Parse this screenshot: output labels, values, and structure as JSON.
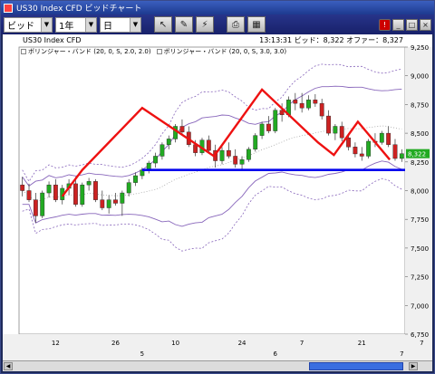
{
  "window": {
    "title": "US30 Index CFD ビッドチャート"
  },
  "toolbar": {
    "price_type": "ビッド",
    "period": "1年",
    "interval": "日",
    "tools": [
      {
        "name": "line-tool-icon",
        "glyph": "↖"
      },
      {
        "name": "pin-tool-icon",
        "glyph": "✎"
      },
      {
        "name": "trend-tool-icon",
        "glyph": "⚡"
      },
      {
        "name": "print-icon",
        "glyph": "⎙"
      },
      {
        "name": "chart-type-icon",
        "glyph": "▦"
      }
    ],
    "right_buttons": [
      {
        "name": "alert-icon",
        "glyph": "!"
      },
      {
        "name": "minimize-icon",
        "glyph": "_"
      },
      {
        "name": "maximize-icon",
        "glyph": "□"
      },
      {
        "name": "close-icon",
        "glyph": "×"
      }
    ]
  },
  "chart_header": {
    "symbol": "US30 Index CFD",
    "info": "13:13:31 ビッド：8,322 オファー：8,327"
  },
  "legend": [
    "ボリンジャー・バンド (20, 0, S, 2.0, 2.0)",
    "ボリンジャー・バンド (20, 0, S, 3.0, 3.0)"
  ],
  "current_price_label": "8,322",
  "chart_data": {
    "type": "candlestick",
    "y_ticks": [
      "9,250",
      "9,000",
      "8,750",
      "8,500",
      "8,250",
      "8,000",
      "7,750",
      "7,500",
      "7,250",
      "7,000",
      "6,750"
    ],
    "ylim": [
      6750,
      9250
    ],
    "x_day_labels": [
      "12",
      "26",
      "10",
      "24",
      "7",
      "21",
      "7"
    ],
    "x_month_labels": [
      "5",
      "6",
      "7"
    ],
    "candles": [
      {
        "o": 8050,
        "h": 8120,
        "l": 7950,
        "c": 8000
      },
      {
        "o": 8000,
        "h": 8060,
        "l": 7900,
        "c": 7920
      },
      {
        "o": 7920,
        "h": 7980,
        "l": 7720,
        "c": 7780
      },
      {
        "o": 7780,
        "h": 8000,
        "l": 7760,
        "c": 7980
      },
      {
        "o": 7980,
        "h": 8080,
        "l": 7940,
        "c": 8050
      },
      {
        "o": 8050,
        "h": 8100,
        "l": 7900,
        "c": 7920
      },
      {
        "o": 7920,
        "h": 8050,
        "l": 7880,
        "c": 8020
      },
      {
        "o": 8020,
        "h": 8100,
        "l": 7960,
        "c": 8060
      },
      {
        "o": 8060,
        "h": 8120,
        "l": 7860,
        "c": 7880
      },
      {
        "o": 7880,
        "h": 8070,
        "l": 7860,
        "c": 8050
      },
      {
        "o": 8050,
        "h": 8110,
        "l": 8000,
        "c": 8080
      },
      {
        "o": 8080,
        "h": 8100,
        "l": 7900,
        "c": 7920
      },
      {
        "o": 7920,
        "h": 8000,
        "l": 7830,
        "c": 7850
      },
      {
        "o": 7850,
        "h": 7960,
        "l": 7800,
        "c": 7920
      },
      {
        "o": 7920,
        "h": 7980,
        "l": 7870,
        "c": 7890
      },
      {
        "o": 7890,
        "h": 8000,
        "l": 7780,
        "c": 7980
      },
      {
        "o": 7980,
        "h": 8100,
        "l": 7950,
        "c": 8070
      },
      {
        "o": 8070,
        "h": 8160,
        "l": 8040,
        "c": 8130
      },
      {
        "o": 8130,
        "h": 8200,
        "l": 8100,
        "c": 8180
      },
      {
        "o": 8180,
        "h": 8260,
        "l": 8150,
        "c": 8240
      },
      {
        "o": 8240,
        "h": 8330,
        "l": 8200,
        "c": 8300
      },
      {
        "o": 8300,
        "h": 8420,
        "l": 8270,
        "c": 8400
      },
      {
        "o": 8400,
        "h": 8480,
        "l": 8360,
        "c": 8450
      },
      {
        "o": 8450,
        "h": 8580,
        "l": 8420,
        "c": 8560
      },
      {
        "o": 8560,
        "h": 8620,
        "l": 8480,
        "c": 8510
      },
      {
        "o": 8510,
        "h": 8560,
        "l": 8380,
        "c": 8400
      },
      {
        "o": 8400,
        "h": 8440,
        "l": 8300,
        "c": 8330
      },
      {
        "o": 8330,
        "h": 8460,
        "l": 8310,
        "c": 8440
      },
      {
        "o": 8440,
        "h": 8480,
        "l": 8320,
        "c": 8350
      },
      {
        "o": 8350,
        "h": 8400,
        "l": 8200,
        "c": 8260
      },
      {
        "o": 8260,
        "h": 8380,
        "l": 8230,
        "c": 8350
      },
      {
        "o": 8350,
        "h": 8420,
        "l": 8280,
        "c": 8300
      },
      {
        "o": 8300,
        "h": 8360,
        "l": 8200,
        "c": 8230
      },
      {
        "o": 8230,
        "h": 8300,
        "l": 8180,
        "c": 8270
      },
      {
        "o": 8270,
        "h": 8380,
        "l": 8250,
        "c": 8360
      },
      {
        "o": 8360,
        "h": 8500,
        "l": 8340,
        "c": 8480
      },
      {
        "o": 8480,
        "h": 8600,
        "l": 8450,
        "c": 8580
      },
      {
        "o": 8580,
        "h": 8650,
        "l": 8500,
        "c": 8520
      },
      {
        "o": 8520,
        "h": 8720,
        "l": 8500,
        "c": 8700
      },
      {
        "o": 8700,
        "h": 8760,
        "l": 8600,
        "c": 8660
      },
      {
        "o": 8660,
        "h": 8820,
        "l": 8640,
        "c": 8790
      },
      {
        "o": 8790,
        "h": 8850,
        "l": 8700,
        "c": 8760
      },
      {
        "o": 8760,
        "h": 8850,
        "l": 8680,
        "c": 8720
      },
      {
        "o": 8720,
        "h": 8830,
        "l": 8700,
        "c": 8790
      },
      {
        "o": 8790,
        "h": 8840,
        "l": 8730,
        "c": 8760
      },
      {
        "o": 8760,
        "h": 8800,
        "l": 8620,
        "c": 8650
      },
      {
        "o": 8650,
        "h": 8700,
        "l": 8480,
        "c": 8500
      },
      {
        "o": 8500,
        "h": 8580,
        "l": 8440,
        "c": 8560
      },
      {
        "o": 8560,
        "h": 8600,
        "l": 8430,
        "c": 8460
      },
      {
        "o": 8460,
        "h": 8500,
        "l": 8350,
        "c": 8380
      },
      {
        "o": 8380,
        "h": 8420,
        "l": 8290,
        "c": 8320
      },
      {
        "o": 8320,
        "h": 8380,
        "l": 8260,
        "c": 8300
      },
      {
        "o": 8300,
        "h": 8450,
        "l": 8280,
        "c": 8430
      },
      {
        "o": 8430,
        "h": 8500,
        "l": 8380,
        "c": 8420
      },
      {
        "o": 8420,
        "h": 8520,
        "l": 8400,
        "c": 8500
      },
      {
        "o": 8500,
        "h": 8560,
        "l": 8380,
        "c": 8400
      },
      {
        "o": 8400,
        "h": 8450,
        "l": 8260,
        "c": 8280
      },
      {
        "o": 8280,
        "h": 8360,
        "l": 8250,
        "c": 8322
      }
    ],
    "zigzag": [
      [
        10,
        7950
      ],
      [
        15,
        8180
      ],
      [
        30,
        8720
      ],
      [
        48,
        8300
      ],
      [
        60,
        8880
      ],
      [
        74,
        8420
      ],
      [
        78,
        8310
      ],
      [
        84,
        8600
      ],
      [
        92,
        8270
      ]
    ],
    "support_level": 8180,
    "colors": {
      "up": "#22aa22",
      "down": "#cc2222",
      "zigzag": "#ee1111",
      "support": "#0000ee",
      "band": "#8866bb",
      "mid": "#999999"
    }
  },
  "scrollbar": {
    "left_arrow": "◀",
    "right_arrow": "▶"
  }
}
